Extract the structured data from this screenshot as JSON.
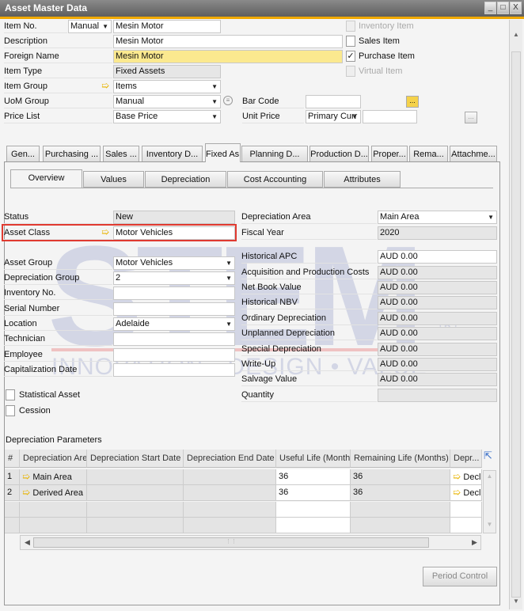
{
  "window": {
    "title": "Asset Master Data",
    "minimize": "_",
    "maximize": "□",
    "close": "X"
  },
  "header": {
    "item_no": {
      "label": "Item No.",
      "series": "Manual",
      "value": "Mesin Motor"
    },
    "description": {
      "label": "Description",
      "value": "Mesin Motor"
    },
    "foreign_name": {
      "label": "Foreign Name",
      "value": "Mesin Motor"
    },
    "item_type": {
      "label": "Item Type",
      "value": "Fixed Assets"
    },
    "item_group": {
      "label": "Item Group",
      "value": "Items"
    },
    "uom_group": {
      "label": "UoM Group",
      "value": "Manual"
    },
    "price_list": {
      "label": "Price List",
      "value": "Base Price"
    },
    "bar_code": {
      "label": "Bar Code",
      "value": "",
      "button": "..."
    },
    "unit_price": {
      "label": "Unit Price",
      "currency": "Primary Curr",
      "value": "",
      "button": "..."
    },
    "checkboxes": [
      {
        "label": "Inventory Item",
        "checked": false,
        "disabled": true
      },
      {
        "label": "Sales Item",
        "checked": false,
        "disabled": false
      },
      {
        "label": "Purchase Item",
        "checked": true,
        "disabled": false
      },
      {
        "label": "Virtual Item",
        "checked": false,
        "disabled": true
      }
    ]
  },
  "tabs": [
    "Gen...",
    "Purchasing ...",
    "Sales ...",
    "Inventory D...",
    "Fixed As...",
    "Planning D...",
    "Production D...",
    "Proper...",
    "Rema...",
    "Attachme..."
  ],
  "active_tab": "Fixed As...",
  "subtabs": [
    "Overview",
    "Values",
    "Depreciation",
    "Cost Accounting",
    "Attributes"
  ],
  "active_subtab": "Overview",
  "left_fields": [
    {
      "label": "Status",
      "value": "New",
      "kind": "ro"
    },
    {
      "label": "Asset Class",
      "value": "Motor Vehicles",
      "kind": "link"
    },
    {
      "label": "Asset Group",
      "value": "Motor Vehicles",
      "kind": "dd"
    },
    {
      "label": "Depreciation Group",
      "value": "2",
      "kind": "dd"
    },
    {
      "label": "Inventory No.",
      "value": "",
      "kind": "text"
    },
    {
      "label": "Serial Number",
      "value": "",
      "kind": "text"
    },
    {
      "label": "Location",
      "value": "Adelaide",
      "kind": "dd"
    },
    {
      "label": "Technician",
      "value": "",
      "kind": "text"
    },
    {
      "label": "Employee",
      "value": "",
      "kind": "text"
    },
    {
      "label": "Capitalization Date",
      "value": "",
      "kind": "text"
    }
  ],
  "left_checkboxes": [
    {
      "label": "Statistical Asset",
      "checked": false
    },
    {
      "label": "Cession",
      "checked": false
    }
  ],
  "right_fields": [
    {
      "label": "Depreciation Area",
      "value": "Main Area",
      "kind": "dd"
    },
    {
      "label": "Fiscal Year",
      "value": "2020",
      "kind": "ro"
    },
    {
      "label": "Historical APC",
      "value": "AUD 0.00",
      "kind": "text"
    },
    {
      "label": "Acquisition and Production Costs",
      "value": "AUD 0.00",
      "kind": "ro"
    },
    {
      "label": "Net Book Value",
      "value": "AUD 0.00",
      "kind": "ro"
    },
    {
      "label": "Historical NBV",
      "value": "AUD 0.00",
      "kind": "ro"
    },
    {
      "label": "Ordinary Depreciation",
      "value": "AUD 0.00",
      "kind": "ro"
    },
    {
      "label": "Unplanned Depreciation",
      "value": "AUD 0.00",
      "kind": "ro"
    },
    {
      "label": "Special Depreciation",
      "value": "AUD 0.00",
      "kind": "ro"
    },
    {
      "label": "Write-Up",
      "value": "AUD 0.00",
      "kind": "ro"
    },
    {
      "label": "Salvage Value",
      "value": "AUD 0.00",
      "kind": "ro"
    },
    {
      "label": "Quantity",
      "value": "",
      "kind": "ro"
    }
  ],
  "depreciation_parameters": {
    "title": "Depreciation Parameters",
    "columns": [
      "#",
      "Depreciation Area",
      "Depreciation Start Date",
      "Depreciation End Date",
      "Useful Life (Months)",
      "Remaining Life (Months)",
      "Depr..."
    ],
    "rows": [
      [
        "1",
        "Main Area",
        "",
        "",
        "36",
        "36",
        "Declir"
      ],
      [
        "2",
        "Derived Area",
        "",
        "",
        "36",
        "36",
        "Declir"
      ],
      [
        "",
        "",
        "",
        "",
        "",
        "",
        ""
      ],
      [
        "",
        "",
        "",
        "",
        "",
        "",
        ""
      ]
    ]
  },
  "buttons": {
    "period_control": "Period Control"
  },
  "watermark": {
    "logo": "STEM",
    "tagline": "INNOVATION • DESIGN • VALUE",
    "mark": "®"
  },
  "colors": {
    "highlight_box": "#e03a30",
    "title_bar": "#6e6e6e",
    "accent": "#f0a800",
    "foreign_name_bg": "#fbe98f"
  }
}
